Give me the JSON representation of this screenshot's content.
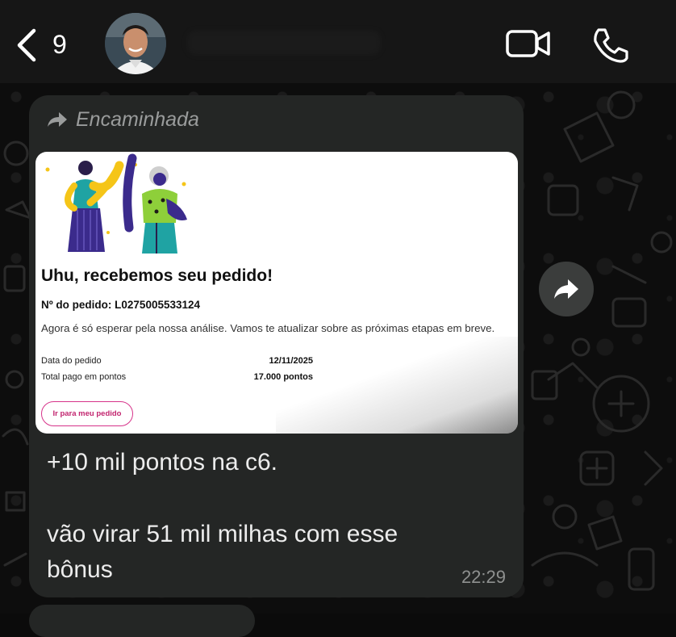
{
  "header": {
    "unread_count": "9",
    "contact_name": "k"
  },
  "message": {
    "forwarded_label": "Encaminhada",
    "card": {
      "title": "Uhu, recebemos seu pedido!",
      "order_number": "Nº do pedido: L0275005533124",
      "description": "Agora é só esperar pela nossa análise. Vamos te atualizar sobre as próximas etapas em breve.",
      "details": [
        {
          "label": "Data do pedido",
          "value": "12/11/2025"
        },
        {
          "label": "Total pago em pontos",
          "value": "17.000 pontos"
        }
      ],
      "button_label": "Ir para meu pedido"
    },
    "text_lines": [
      "+10 mil pontos na c6.",
      "",
      "vão virar 51 mil milhas com esse",
      "bônus"
    ],
    "time": "22:29"
  },
  "icons": {
    "back": "chevron-left-icon",
    "video": "video-camera-icon",
    "phone": "phone-icon",
    "forwarded": "forward-arrow-icon",
    "forward_button": "share-arrow-icon"
  },
  "colors": {
    "bubble": "#242625",
    "header": "#161616",
    "button_accent": "#d6338a"
  }
}
